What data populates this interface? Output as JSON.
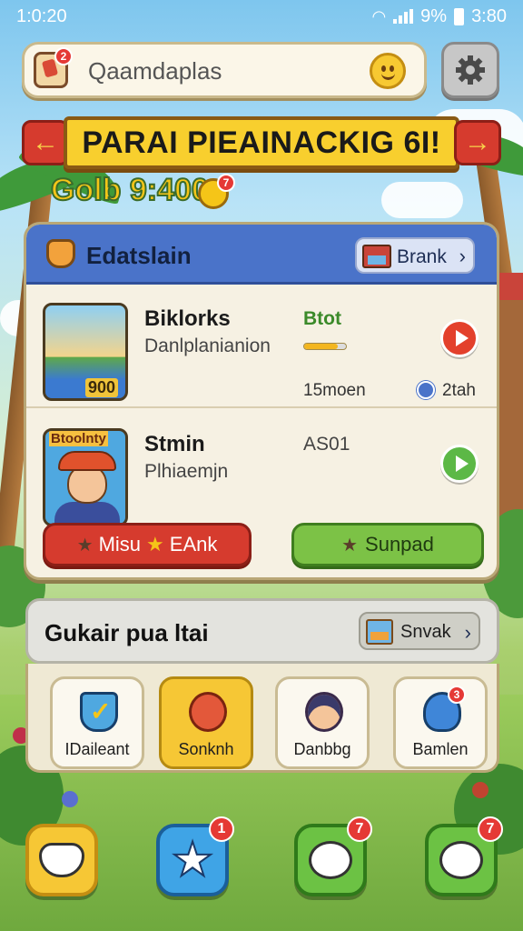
{
  "status_bar": {
    "time_left": "1:0:20",
    "battery": "9%",
    "time_right": "3:80"
  },
  "search": {
    "text": "Qaamdaplas",
    "bag_badge": "2"
  },
  "banner": {
    "title": "PARAI PIEAINACKIG 6I!"
  },
  "coins": {
    "value": "Golb 9:400",
    "badge": "7"
  },
  "main_card": {
    "title": "Edatslain",
    "rank_label": "Brank",
    "items": [
      {
        "name": "Biklorks",
        "subtitle": "Danlplanianion",
        "tag": "Btot",
        "time": "15moen",
        "meta": "2tah",
        "thumb_label": "900",
        "progress": 0.8
      },
      {
        "name": "Stmin",
        "subtitle": "Plhiaemjn",
        "tag": "AS01",
        "thumb_label": "Btoolnty"
      }
    ],
    "red_button": {
      "left": "Misu",
      "right": "EAnk"
    },
    "green_button": {
      "label": "Sunpad"
    }
  },
  "panel2": {
    "title": "Gukair pua ltai",
    "button_label": "Snvak",
    "tiles": [
      {
        "label": "IDaileant",
        "icon": "shield-check-icon"
      },
      {
        "label": "Sonknh",
        "icon": "speech-bubble-icon",
        "badge": ""
      },
      {
        "label": "Danbbg",
        "icon": "girl-avatar-icon"
      },
      {
        "label": "Bamlen",
        "icon": "blob-icon",
        "badge": "3"
      }
    ]
  },
  "dock": [
    {
      "icon": "cat-face-icon",
      "badge": ""
    },
    {
      "icon": "star-icon",
      "badge": "1"
    },
    {
      "icon": "cloud-chat-icon",
      "badge": "7"
    },
    {
      "icon": "smile-chat-icon",
      "badge": "7"
    }
  ],
  "colors": {
    "banner": "#f8cf2e",
    "card_header": "#4a73c9",
    "accent_red": "#d63b2e",
    "accent_green": "#7cc246"
  }
}
